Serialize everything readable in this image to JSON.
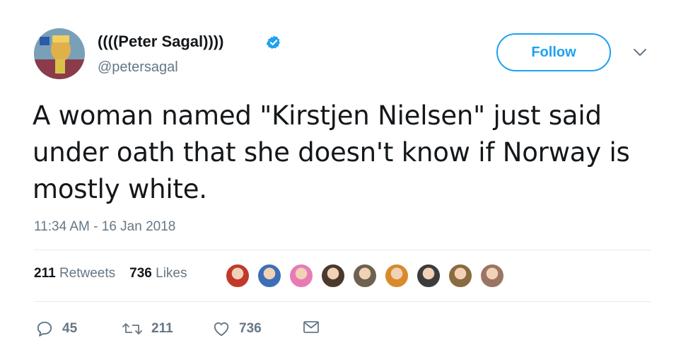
{
  "user": {
    "display_name": "((((Peter Sagal))))",
    "handle": "@petersagal",
    "verified": true,
    "avatar_icon": "user-avatar"
  },
  "follow": {
    "label": "Follow"
  },
  "tweet": {
    "text": "A woman named \"Kirstjen Nielsen\" just said under oath that she doesn't know if Norway is mostly white.",
    "timestamp": "11:34 AM - 16 Jan 2018"
  },
  "stats": {
    "retweets_count": "211",
    "retweets_label": "Retweets",
    "likes_count": "736",
    "likes_label": "Likes"
  },
  "liker_avatars": [
    {
      "color": "#c0392b"
    },
    {
      "color": "#3d6fb6"
    },
    {
      "color": "#e77bb5"
    },
    {
      "color": "#4a3a2e"
    },
    {
      "color": "#6d6150"
    },
    {
      "color": "#d98a2b"
    },
    {
      "color": "#3c3c3c"
    },
    {
      "color": "#8a6a3f"
    },
    {
      "color": "#9b7463"
    }
  ],
  "actions": {
    "reply_count": "45",
    "retweet_count": "211",
    "like_count": "736"
  },
  "colors": {
    "accent": "#1da1f2",
    "text": "#14171a",
    "secondary": "#657786",
    "divider": "#e6ecf0"
  }
}
